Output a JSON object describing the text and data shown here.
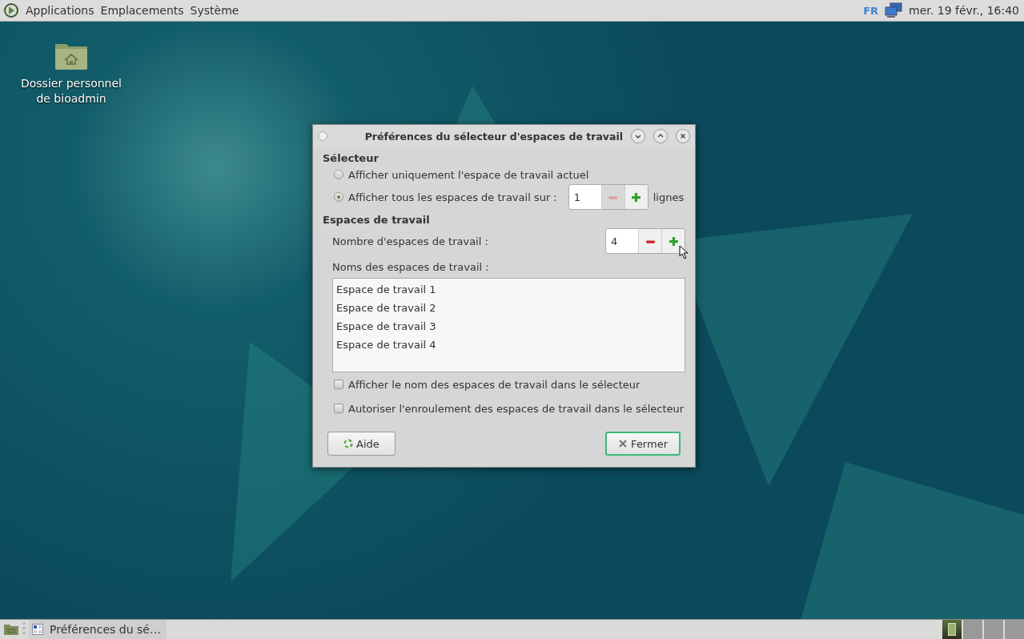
{
  "top_panel": {
    "menus": [
      "Applications",
      "Emplacements",
      "Système"
    ],
    "keyboard_layout": "FR",
    "clock": "mer. 19 févr., 16:40"
  },
  "desktop_icons": [
    {
      "label": "Dossier personnel de bioadmin"
    }
  ],
  "dialog": {
    "title": "Préférences du sélecteur d'espaces de travail",
    "switcher_section": {
      "heading": "Sélecteur",
      "options": [
        {
          "label": "Afficher uniquement l'espace de travail actuel",
          "selected": false
        },
        {
          "label": "Afficher tous les espaces de travail sur :",
          "selected": true,
          "spinner": {
            "value": "1",
            "decrement_disabled": true
          },
          "suffix": "lignes"
        }
      ]
    },
    "workspaces_section": {
      "heading": "Espaces de travail",
      "count_label": "Nombre d'espaces de travail :",
      "count_spinner": {
        "value": "4",
        "decrement_disabled": false
      },
      "names_label": "Noms des espaces de travail :",
      "names": [
        "Espace de travail 1",
        "Espace de travail 2",
        "Espace de travail 3",
        "Espace de travail 4"
      ]
    },
    "checkboxes": [
      {
        "label": "Afficher le nom des espaces de travail dans le sélecteur",
        "checked": false
      },
      {
        "label": "Autoriser l'enroulement des espaces de travail dans le sélecteur",
        "checked": false
      }
    ],
    "buttons": [
      {
        "kind": "help",
        "label": "Aide"
      },
      {
        "kind": "close",
        "label": "Fermer"
      }
    ]
  },
  "bottom_panel": {
    "tasks": [
      {
        "label": "Préférences du sé…",
        "selected": false
      }
    ],
    "workspaces": [
      {
        "selected": true
      },
      {
        "selected": false
      },
      {
        "selected": false
      },
      {
        "selected": false
      }
    ]
  }
}
